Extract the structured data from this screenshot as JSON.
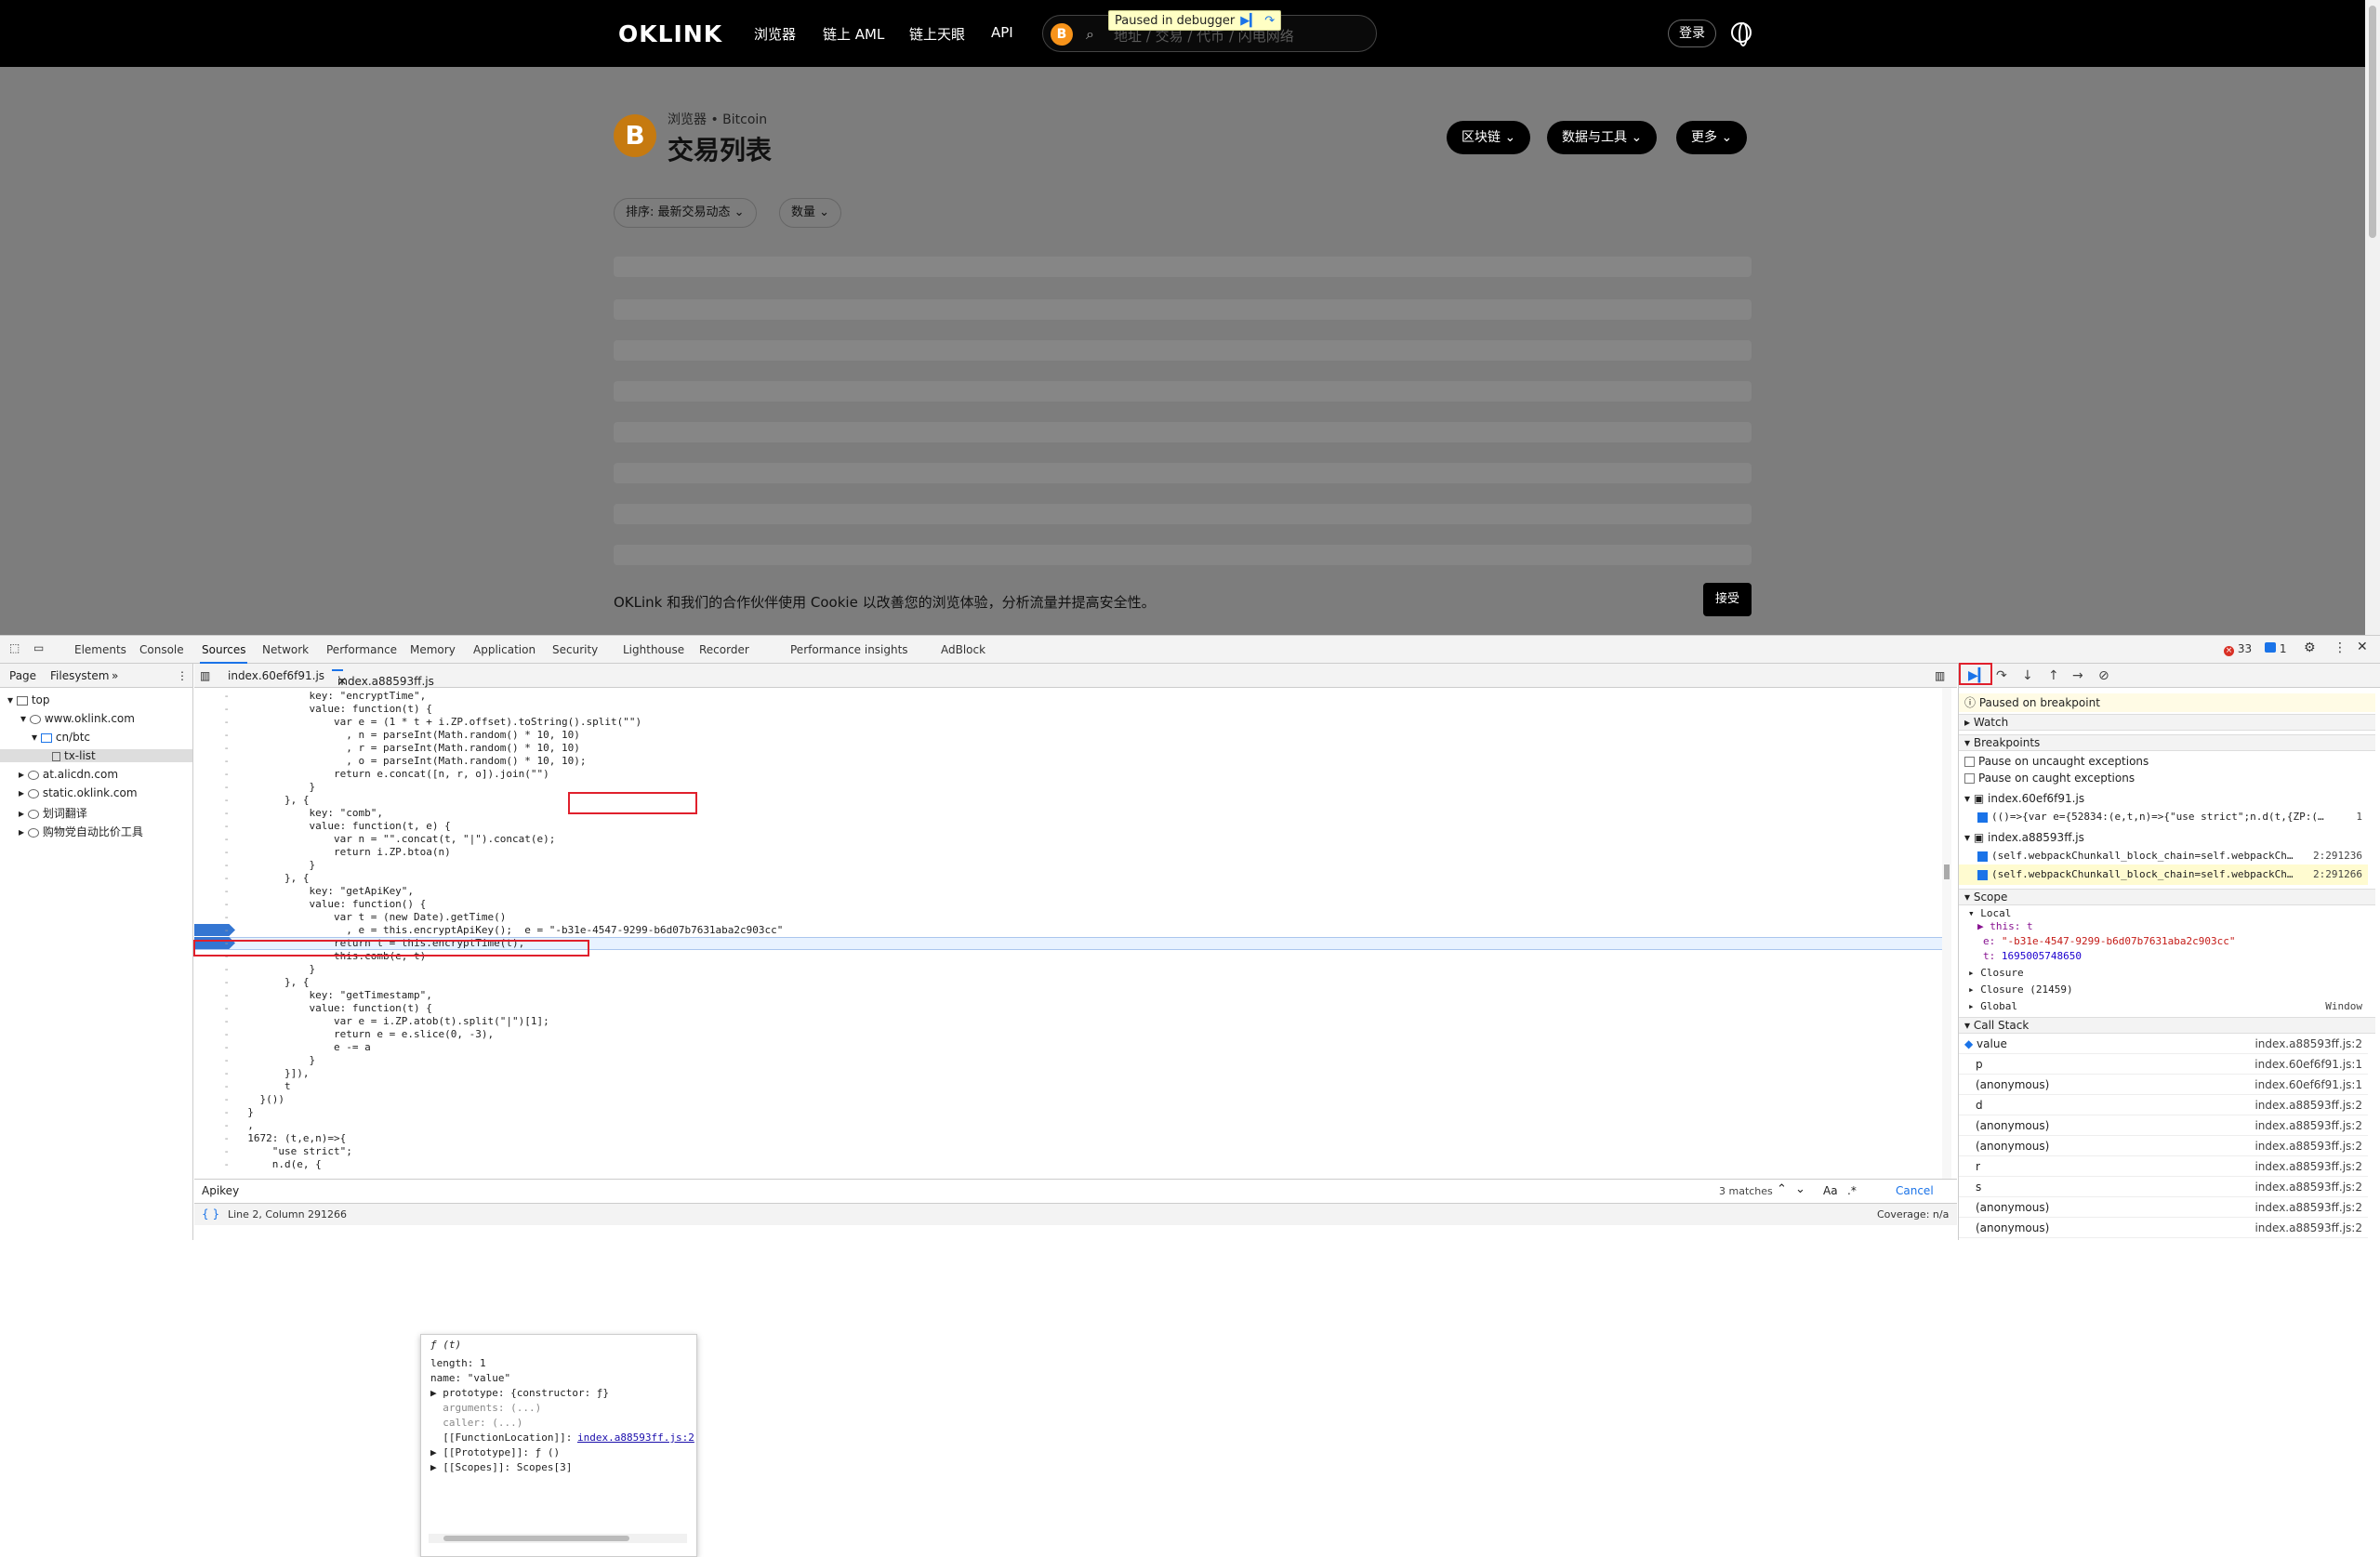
{
  "site": {
    "logo": "OKLINK",
    "nav": [
      "浏览器",
      "链上 AML",
      "链上天眼",
      "API"
    ],
    "search_placeholder": "地址 / 交易 / 代币 / 闪电网络",
    "paused_banner": "Paused in debugger",
    "login": "登录",
    "breadcrumb": "浏览器 • Bitcoin",
    "title": "交易列表",
    "buttons": [
      "区块链",
      "数据与工具",
      "更多"
    ],
    "filters": [
      "排序: 最新交易动态",
      "数量"
    ],
    "cookie_text": "OKLink 和我们的合作伙伴使用 Cookie 以改善您的浏览体验，分析流量并提高安全性。",
    "accept": "接受",
    "coin_letter": "B"
  },
  "devtools": {
    "tabs": [
      "Elements",
      "Console",
      "Sources",
      "Network",
      "Performance",
      "Memory",
      "Application",
      "Security",
      "Lighthouse",
      "Recorder",
      "Performance insights",
      "AdBlock"
    ],
    "active_tab": "Sources",
    "error_count": "33",
    "message_count": "1",
    "navigator_tabs": [
      "Page",
      "Filesystem"
    ],
    "tree": [
      {
        "label": "top"
      },
      {
        "label": "www.oklink.com"
      },
      {
        "label": "cn/btc"
      },
      {
        "label": "tx-list"
      },
      {
        "label": "at.alicdn.com"
      },
      {
        "label": "static.oklink.com"
      },
      {
        "label": "划词翻译"
      },
      {
        "label": "购物党自动比价工具"
      }
    ],
    "editor_tabs": [
      "index.60ef6f91.js",
      "index.a88593ff.js"
    ],
    "code": [
      "            key: \"encryptTime\",",
      "            value: function(t) {",
      "                var e = (1 * t + i.ZP.offset).toString().split(\"\")",
      "                  , n = parseInt(Math.random() * 10, 10)",
      "                  , r = parseInt(Math.random() * 10, 10)",
      "                  , o = parseInt(Math.random() * 10, 10);",
      "                return e.concat([n, r, o]).join(\"\")",
      "            }",
      "        }, {",
      "            key: \"comb\",",
      "            value: function(t, e) {",
      "                var n = \"\".concat(t, \"|\").concat(e);",
      "                return i.ZP.btoa(n)",
      "            }",
      "        }, {",
      "            key: \"getApiKey\",",
      "            value: function() {",
      "                var t = (new Date).getTime()",
      "                  , e = this.encryptApiKey();  e = \"-b31e-4547-9299-b6d07b7631aba2c903cc\"",
      "                return t = this.encryptTime(t),",
      "                this.comb(e, t)",
      "            }",
      "        }, {",
      "            key: \"getTimestamp\",",
      "            value: function(t) {",
      "                var e = i.ZP.atob(t).split(\"|\")[1];",
      "                return e = e.slice(0, -3),",
      "                e -= a",
      "            }",
      "        }]),",
      "        t",
      "    }())",
      "  }",
      "  ,",
      "  1672: (t,e,n)=>{",
      "      \"use strict\";",
      "      n.d(e, {"
    ],
    "popover": {
      "title": "ƒ (t)",
      "lines": [
        "length: 1",
        "name: \"value\"",
        "▶ prototype: {constructor: ƒ}",
        "  arguments: (...)",
        "  caller: (...)",
        "  [[FunctionLocation]]: ",
        "▶ [[Prototype]]: ƒ ()",
        "▶ [[Scopes]]: Scopes[3]"
      ],
      "location_link": "index.a88593ff.js:2"
    },
    "search_value": "Apikey",
    "search_matches": "3 matches",
    "search_case": "Aa",
    "search_regex": ".*",
    "search_cancel": "Cancel",
    "status_position": "Line 2, Column 291266",
    "coverage": "Coverage: n/a",
    "debugger": {
      "paused": "Paused on breakpoint",
      "watch": "Watch",
      "breakpoints": "Breakpoints",
      "pause_uncaught": "Pause on uncaught exceptions",
      "pause_caught": "Pause on caught exceptions",
      "bp_files": [
        {
          "file": "index.60ef6f91.js",
          "items": [
            {
              "code": "(()=>{var e={52834:(e,t,n)=>{\"use strict\";n.d(t,{ZP:(…",
              "line": "1"
            }
          ]
        },
        {
          "file": "index.a88593ff.js",
          "items": [
            {
              "code": "(self.webpackChunkall_block_chain=self.webpackCh…",
              "line": "2:291236"
            },
            {
              "code": "(self.webpackChunkall_block_chain=self.webpackCh…",
              "line": "2:291266"
            }
          ]
        }
      ],
      "scope": "Scope",
      "local": "Local",
      "this_var": "▶ this: t",
      "e_var_name": "e:",
      "e_var_value": "\"-b31e-4547-9299-b6d07b7631aba2c903cc\"",
      "t_var_name": "t:",
      "t_var_value": "1695005748650",
      "closures": [
        "Closure",
        "Closure (21459)",
        "Global"
      ],
      "global_value": "Window",
      "callstack": "Call Stack",
      "frames": [
        {
          "name": "value",
          "loc": "index.a88593ff.js:2"
        },
        {
          "name": "p",
          "loc": "index.60ef6f91.js:1"
        },
        {
          "name": "(anonymous)",
          "loc": "index.60ef6f91.js:1"
        },
        {
          "name": "d",
          "loc": "index.a88593ff.js:2"
        },
        {
          "name": "(anonymous)",
          "loc": "index.a88593ff.js:2"
        },
        {
          "name": "(anonymous)",
          "loc": "index.a88593ff.js:2"
        },
        {
          "name": "r",
          "loc": "index.a88593ff.js:2"
        },
        {
          "name": "s",
          "loc": "index.a88593ff.js:2"
        },
        {
          "name": "(anonymous)",
          "loc": "index.a88593ff.js:2"
        },
        {
          "name": "(anonymous)",
          "loc": "index.a88593ff.js:2"
        }
      ]
    }
  }
}
